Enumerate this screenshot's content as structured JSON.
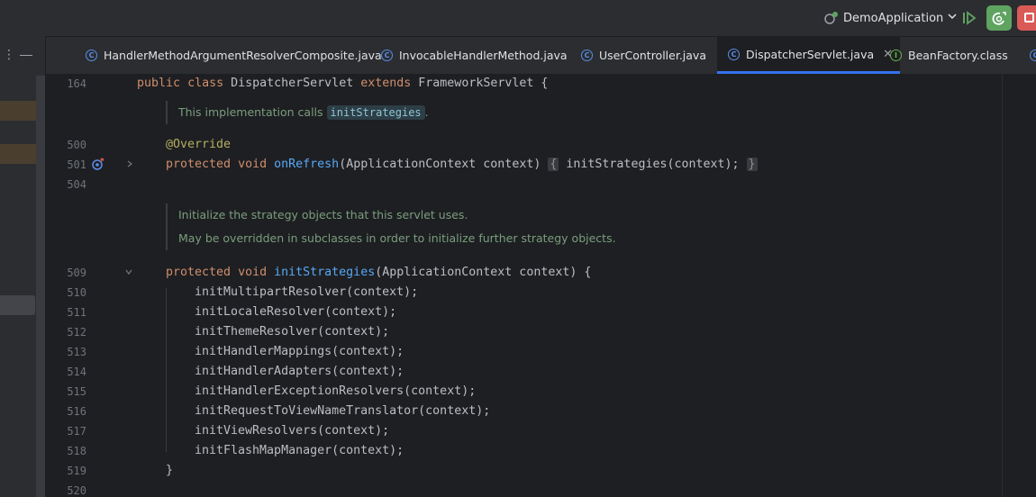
{
  "toolbar": {
    "run_config": "DemoApplication",
    "colors": {
      "run": "#5fa361",
      "debug": "#5fa361",
      "stop": "#d95a56"
    }
  },
  "tabs": [
    {
      "label": "HandlerMethodArgumentResolverComposite.java",
      "icon": "class-icon",
      "active": false
    },
    {
      "label": "InvocableHandlerMethod.java",
      "icon": "class-icon",
      "active": false
    },
    {
      "label": "UserController.java",
      "icon": "class-icon",
      "active": false
    },
    {
      "label": "DispatcherServlet.java",
      "icon": "class-icon",
      "active": true
    },
    {
      "label": "BeanFactory.class",
      "icon": "interface-icon",
      "active": false
    }
  ],
  "editor": {
    "line_numbers": [
      "164",
      "500",
      "501",
      "504",
      "509",
      "510",
      "511",
      "512",
      "513",
      "514",
      "515",
      "516",
      "517",
      "518",
      "519",
      "520"
    ],
    "class_decl": {
      "kw1": "public",
      "kw2": "class",
      "name": "DispatcherServlet",
      "kw3": "extends",
      "parent": "FrameworkServlet",
      "brace": "{"
    },
    "doc1": {
      "text": "This implementation calls",
      "code": "initStrategies",
      "end": "."
    },
    "annotation": "@Override",
    "onrefresh": {
      "kw1": "protected",
      "kw2": "void",
      "name": "onRefresh",
      "params": "(ApplicationContext context)",
      "fold_open": "{",
      "body": "initStrategies(context);",
      "fold_close": "}"
    },
    "doc2": [
      "Initialize the strategy objects that this servlet uses.",
      "May be overridden in subclasses in order to initialize further strategy objects."
    ],
    "initstrategies": {
      "kw1": "protected",
      "kw2": "void",
      "name": "initStrategies",
      "params": "(ApplicationContext context) {"
    },
    "body_lines": [
      "initMultipartResolver(context);",
      "initLocaleResolver(context);",
      "initThemeResolver(context);",
      "initHandlerMappings(context);",
      "initHandlerAdapters(context);",
      "initHandlerExceptionResolvers(context);",
      "initRequestToViewNameTranslator(context);",
      "initViewResolvers(context);",
      "initFlashMapManager(context);"
    ],
    "closing_brace": "}"
  }
}
